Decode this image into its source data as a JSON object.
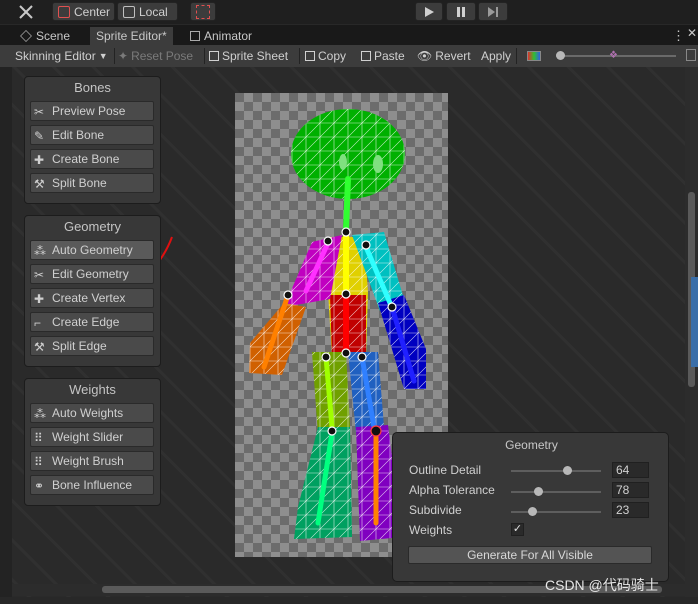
{
  "topbar": {
    "pivot_center": "Center",
    "pivot_local": "Local"
  },
  "tabs": [
    {
      "label": "Scene"
    },
    {
      "label": "Sprite Editor*"
    },
    {
      "label": "Animator"
    }
  ],
  "toolbar": {
    "mode_dropdown": "Skinning Editor",
    "reset_pose": "Reset Pose",
    "sprite_sheet": "Sprite Sheet",
    "copy": "Copy",
    "paste": "Paste",
    "revert": "Revert",
    "apply": "Apply"
  },
  "bones_panel": {
    "title": "Bones",
    "buttons": [
      {
        "label": "Preview Pose",
        "icon": "preview-pose-icon"
      },
      {
        "label": "Edit Bone",
        "icon": "edit-bone-icon"
      },
      {
        "label": "Create Bone",
        "icon": "create-bone-icon"
      },
      {
        "label": "Split Bone",
        "icon": "split-bone-icon"
      }
    ]
  },
  "geometry_panel": {
    "title": "Geometry",
    "buttons": [
      {
        "label": "Auto Geometry",
        "icon": "auto-geometry-icon"
      },
      {
        "label": "Edit Geometry",
        "icon": "edit-geometry-icon"
      },
      {
        "label": "Create Vertex",
        "icon": "create-vertex-icon"
      },
      {
        "label": "Create Edge",
        "icon": "create-edge-icon"
      },
      {
        "label": "Split Edge",
        "icon": "split-edge-icon"
      }
    ]
  },
  "weights_panel": {
    "title": "Weights",
    "buttons": [
      {
        "label": "Auto Weights",
        "icon": "auto-weights-icon"
      },
      {
        "label": "Weight Slider",
        "icon": "weight-slider-icon"
      },
      {
        "label": "Weight Brush",
        "icon": "weight-brush-icon"
      },
      {
        "label": "Bone Influence",
        "icon": "bone-influence-icon"
      }
    ]
  },
  "geometry_settings": {
    "title": "Geometry",
    "outline_detail": {
      "label": "Outline Detail",
      "value": "64",
      "fraction": 0.62
    },
    "alpha_tolerance": {
      "label": "Alpha Tolerance",
      "value": "78",
      "fraction": 0.3
    },
    "subdivide": {
      "label": "Subdivide",
      "value": "23",
      "fraction": 0.23
    },
    "weights": {
      "label": "Weights",
      "checked": true
    },
    "generate_button": "Generate For All Visible"
  },
  "watermark": "CSDN @代码骑士",
  "colors": {
    "annotation_red": "#e01010",
    "head_green": "#00b000"
  }
}
